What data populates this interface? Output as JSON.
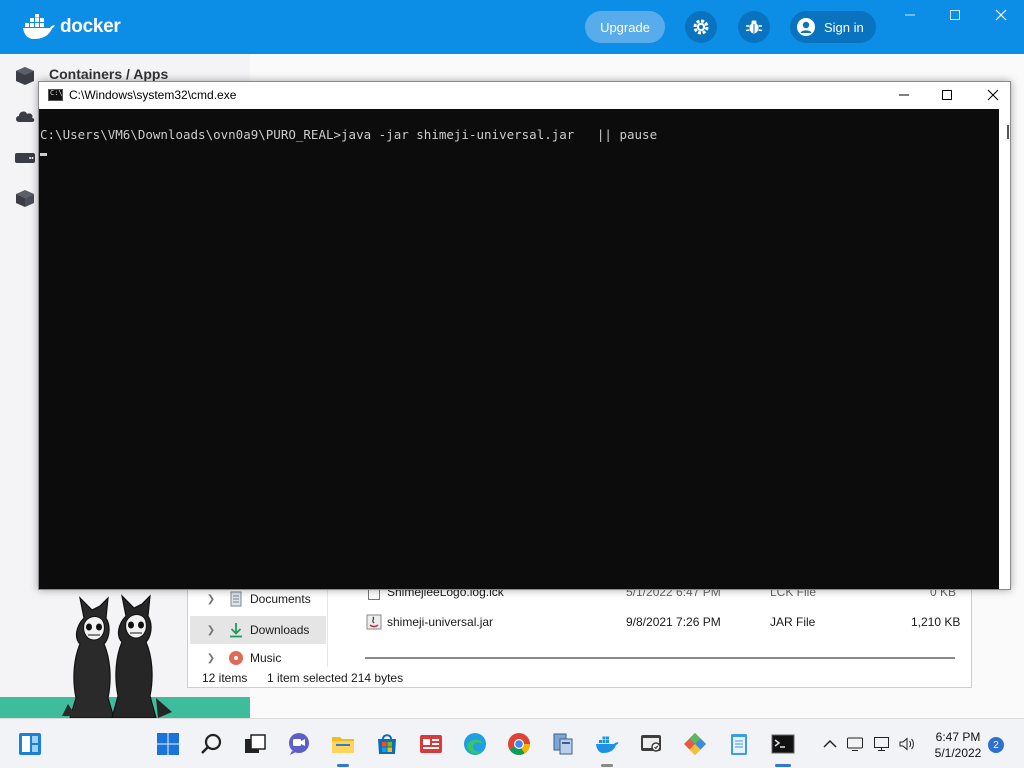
{
  "docker": {
    "logo_text": "docker",
    "upgrade_label": "Upgrade",
    "signin_label": "Sign in",
    "section_title": "Containers / Apps",
    "colors": {
      "header": "#0d8ee6",
      "accent_strip": "#3dbd9c"
    }
  },
  "cmd": {
    "title": "C:\\Windows\\system32\\cmd.exe",
    "prompt_line": "C:\\Users\\VM6\\Downloads\\ovn0a9\\PURO_REAL>java -jar shimeji-universal.jar   || pause"
  },
  "explorer": {
    "nav": [
      {
        "label": "Documents",
        "icon": "documents-icon"
      },
      {
        "label": "Downloads",
        "icon": "downloads-icon",
        "selected": true
      },
      {
        "label": "Music",
        "icon": "music-icon"
      }
    ],
    "files": [
      {
        "name": "ShimejieeLogo.log.lck",
        "date": "5/1/2022 6:47 PM",
        "type": "LCK File",
        "size": "0 KB"
      },
      {
        "name": "shimeji-universal.jar",
        "date": "9/8/2021 7:26 PM",
        "type": "JAR File",
        "size": "1,210 KB"
      }
    ],
    "status": {
      "items": "12 items",
      "selected": "1 item selected  214 bytes"
    }
  },
  "taskbar": {
    "time": "6:47 PM",
    "date": "5/1/2022",
    "notifications": "2"
  }
}
